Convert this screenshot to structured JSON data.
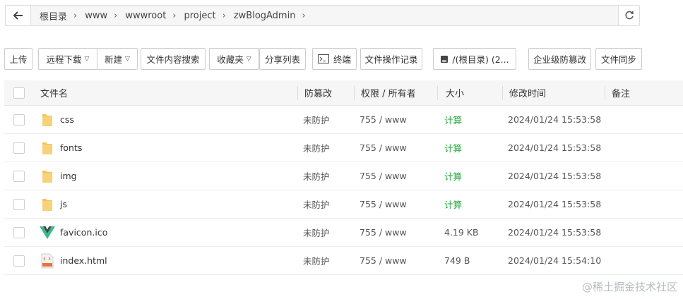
{
  "breadcrumb": {
    "items": [
      "根目录",
      "www",
      "wwwroot",
      "project",
      "zwBlogAdmin"
    ],
    "separator": "›"
  },
  "toolbar": {
    "upload": "上传",
    "remote_download": "远程下载",
    "new": "新建",
    "content_search": "文件内容搜索",
    "favorites": "收藏夹",
    "share_list": "分享列表",
    "terminal": "终端",
    "op_log": "文件操作记录",
    "disk": "/(根目录) (2...",
    "tamper_enterprise": "企业级防篡改",
    "file_sync": "文件同步"
  },
  "table": {
    "headers": {
      "name": "文件名",
      "tamper": "防篡改",
      "perm": "权限 / 所有者",
      "size": "大小",
      "mtime": "修改时间",
      "note": "备注"
    },
    "rows": [
      {
        "name": "css",
        "tamper": "未防护",
        "perm": "755 / www",
        "size": "计算",
        "mtime": "2024/01/24 15:53:58"
      },
      {
        "name": "fonts",
        "tamper": "未防护",
        "perm": "755 / www",
        "size": "计算",
        "mtime": "2024/01/24 15:53:58"
      },
      {
        "name": "img",
        "tamper": "未防护",
        "perm": "755 / www",
        "size": "计算",
        "mtime": "2024/01/24 15:53:58"
      },
      {
        "name": "js",
        "tamper": "未防护",
        "perm": "755 / www",
        "size": "计算",
        "mtime": "2024/01/24 15:53:58"
      },
      {
        "name": "favicon.ico",
        "tamper": "未防护",
        "perm": "755 / www",
        "size": "4.19 KB",
        "mtime": "2024/01/24 15:53:58"
      },
      {
        "name": "index.html",
        "tamper": "未防护",
        "perm": "755 / www",
        "size": "749 B",
        "mtime": "2024/01/24 15:54:10"
      }
    ],
    "row_icons": [
      "folder-icon",
      "folder-icon",
      "folder-icon",
      "folder-icon",
      "vue-logo-icon",
      "html-file-icon"
    ]
  },
  "watermark": "@稀土掘金技术社区",
  "colors": {
    "calc_link": "#20a53a",
    "folder": "#f5c451",
    "vue_green": "#41b883",
    "vue_dark": "#35495e"
  }
}
